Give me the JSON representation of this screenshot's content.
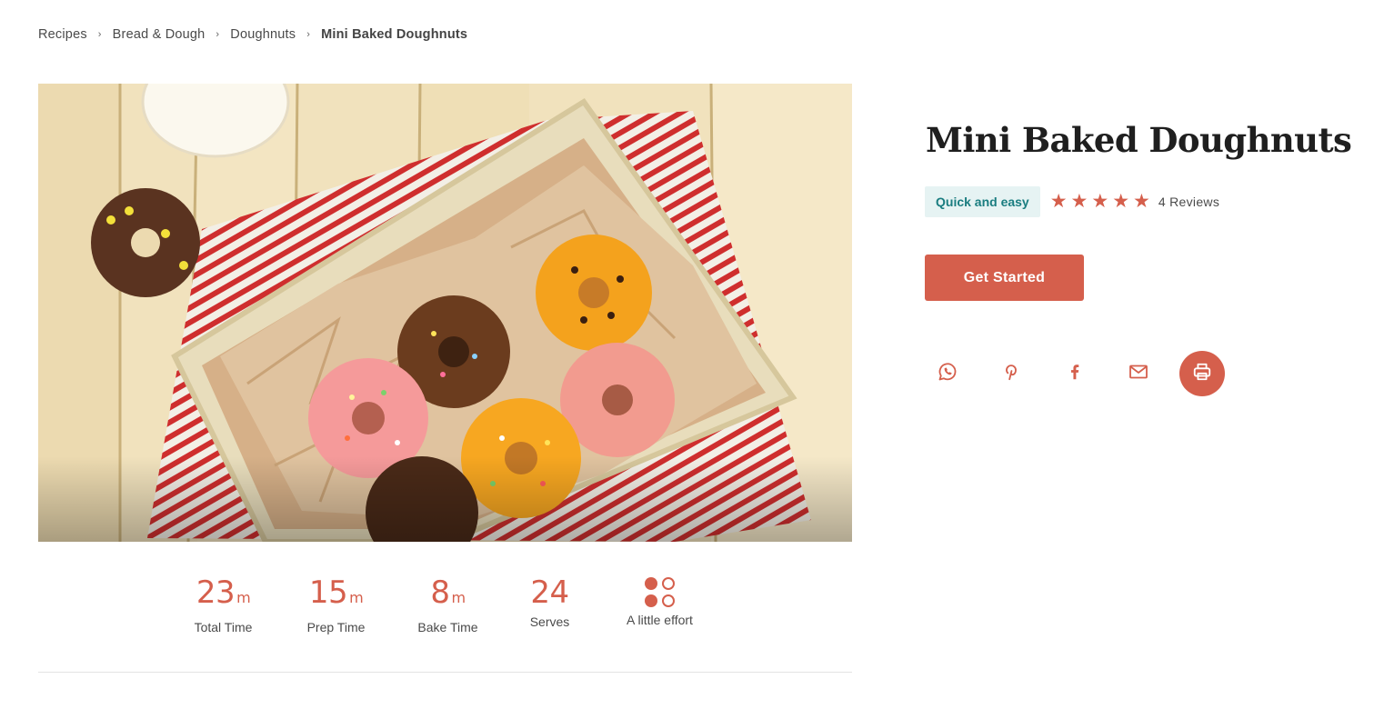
{
  "breadcrumb": {
    "items": [
      "Recipes",
      "Bread & Dough",
      "Doughnuts"
    ],
    "separator": "›",
    "current": "Mini Baked Doughnuts"
  },
  "recipe": {
    "title": "Mini Baked Doughnuts",
    "tag": "Quick and easy",
    "rating": 5,
    "reviews": "4 Reviews",
    "cta_label": "Get Started"
  },
  "share": {
    "icons": [
      "whatsapp-icon",
      "pinterest-icon",
      "facebook-icon",
      "email-icon",
      "print-icon"
    ]
  },
  "stats": [
    {
      "value": "23",
      "unit": "m",
      "label": "Total Time"
    },
    {
      "value": "15",
      "unit": "m",
      "label": "Prep Time"
    },
    {
      "value": "8",
      "unit": "m",
      "label": "Bake Time"
    },
    {
      "value": "24",
      "unit": "",
      "label": "Serves"
    },
    {
      "label": "A little effort"
    }
  ],
  "colors": {
    "accent": "#d55f4c",
    "tag_bg": "#e6f3f3",
    "tag_text": "#1a7d80"
  }
}
